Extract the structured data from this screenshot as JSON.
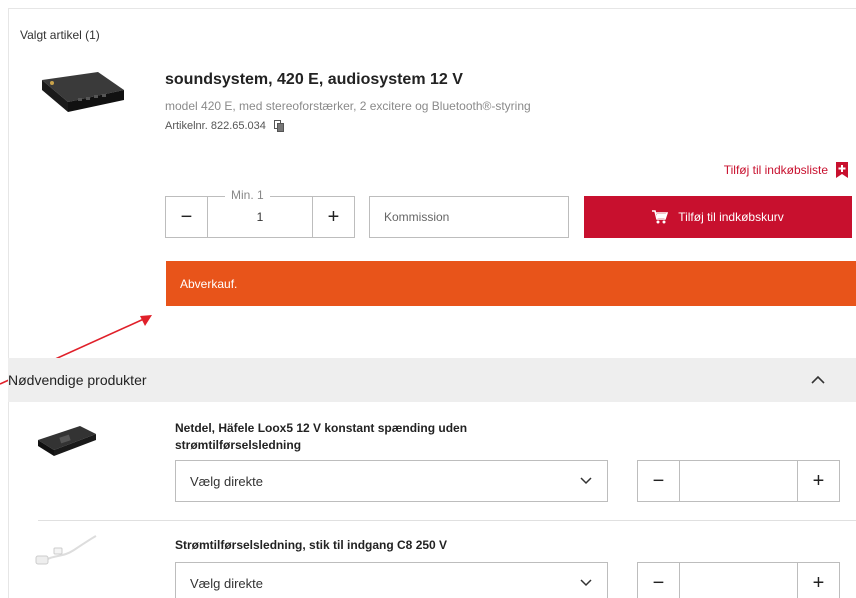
{
  "selected": {
    "heading": "Valgt artikel (1)",
    "product": {
      "title": "soundsystem, 420 E, audiosystem 12 V",
      "description": "model 420 E, med stereoforstærker, 2 excitere og Bluetooth®-styring",
      "article_no": "Artikelnr. 822.65.034",
      "image_icon": "audio-device-image"
    },
    "wishlist_label": "Tilføj til indkøbsliste",
    "quantity": {
      "min_label": "Min. 1",
      "value": "1",
      "minus": "−",
      "plus": "+"
    },
    "commission_placeholder": "Kommission",
    "add_to_cart_label": "Tilføj til indkøbskurv",
    "banner_text": "Abverkauf."
  },
  "needed": {
    "heading": "Nødvendige produkter",
    "items": [
      {
        "title": "Netdel, Häfele Loox5 12 V konstant spænding uden strømtilførselsledning",
        "select_label": "Vælg direkte",
        "minus": "−",
        "plus": "+",
        "image_icon": "power-supply-image"
      },
      {
        "title": "Strømtilførselsledning, stik til indgang C8 250 V",
        "select_label": "Vælg direkte",
        "minus": "−",
        "plus": "+",
        "image_icon": "power-cable-image"
      }
    ]
  },
  "colors": {
    "brand_red": "#c8102e",
    "banner_orange": "#e8541a",
    "annotation_arrow": "#e0202a"
  }
}
